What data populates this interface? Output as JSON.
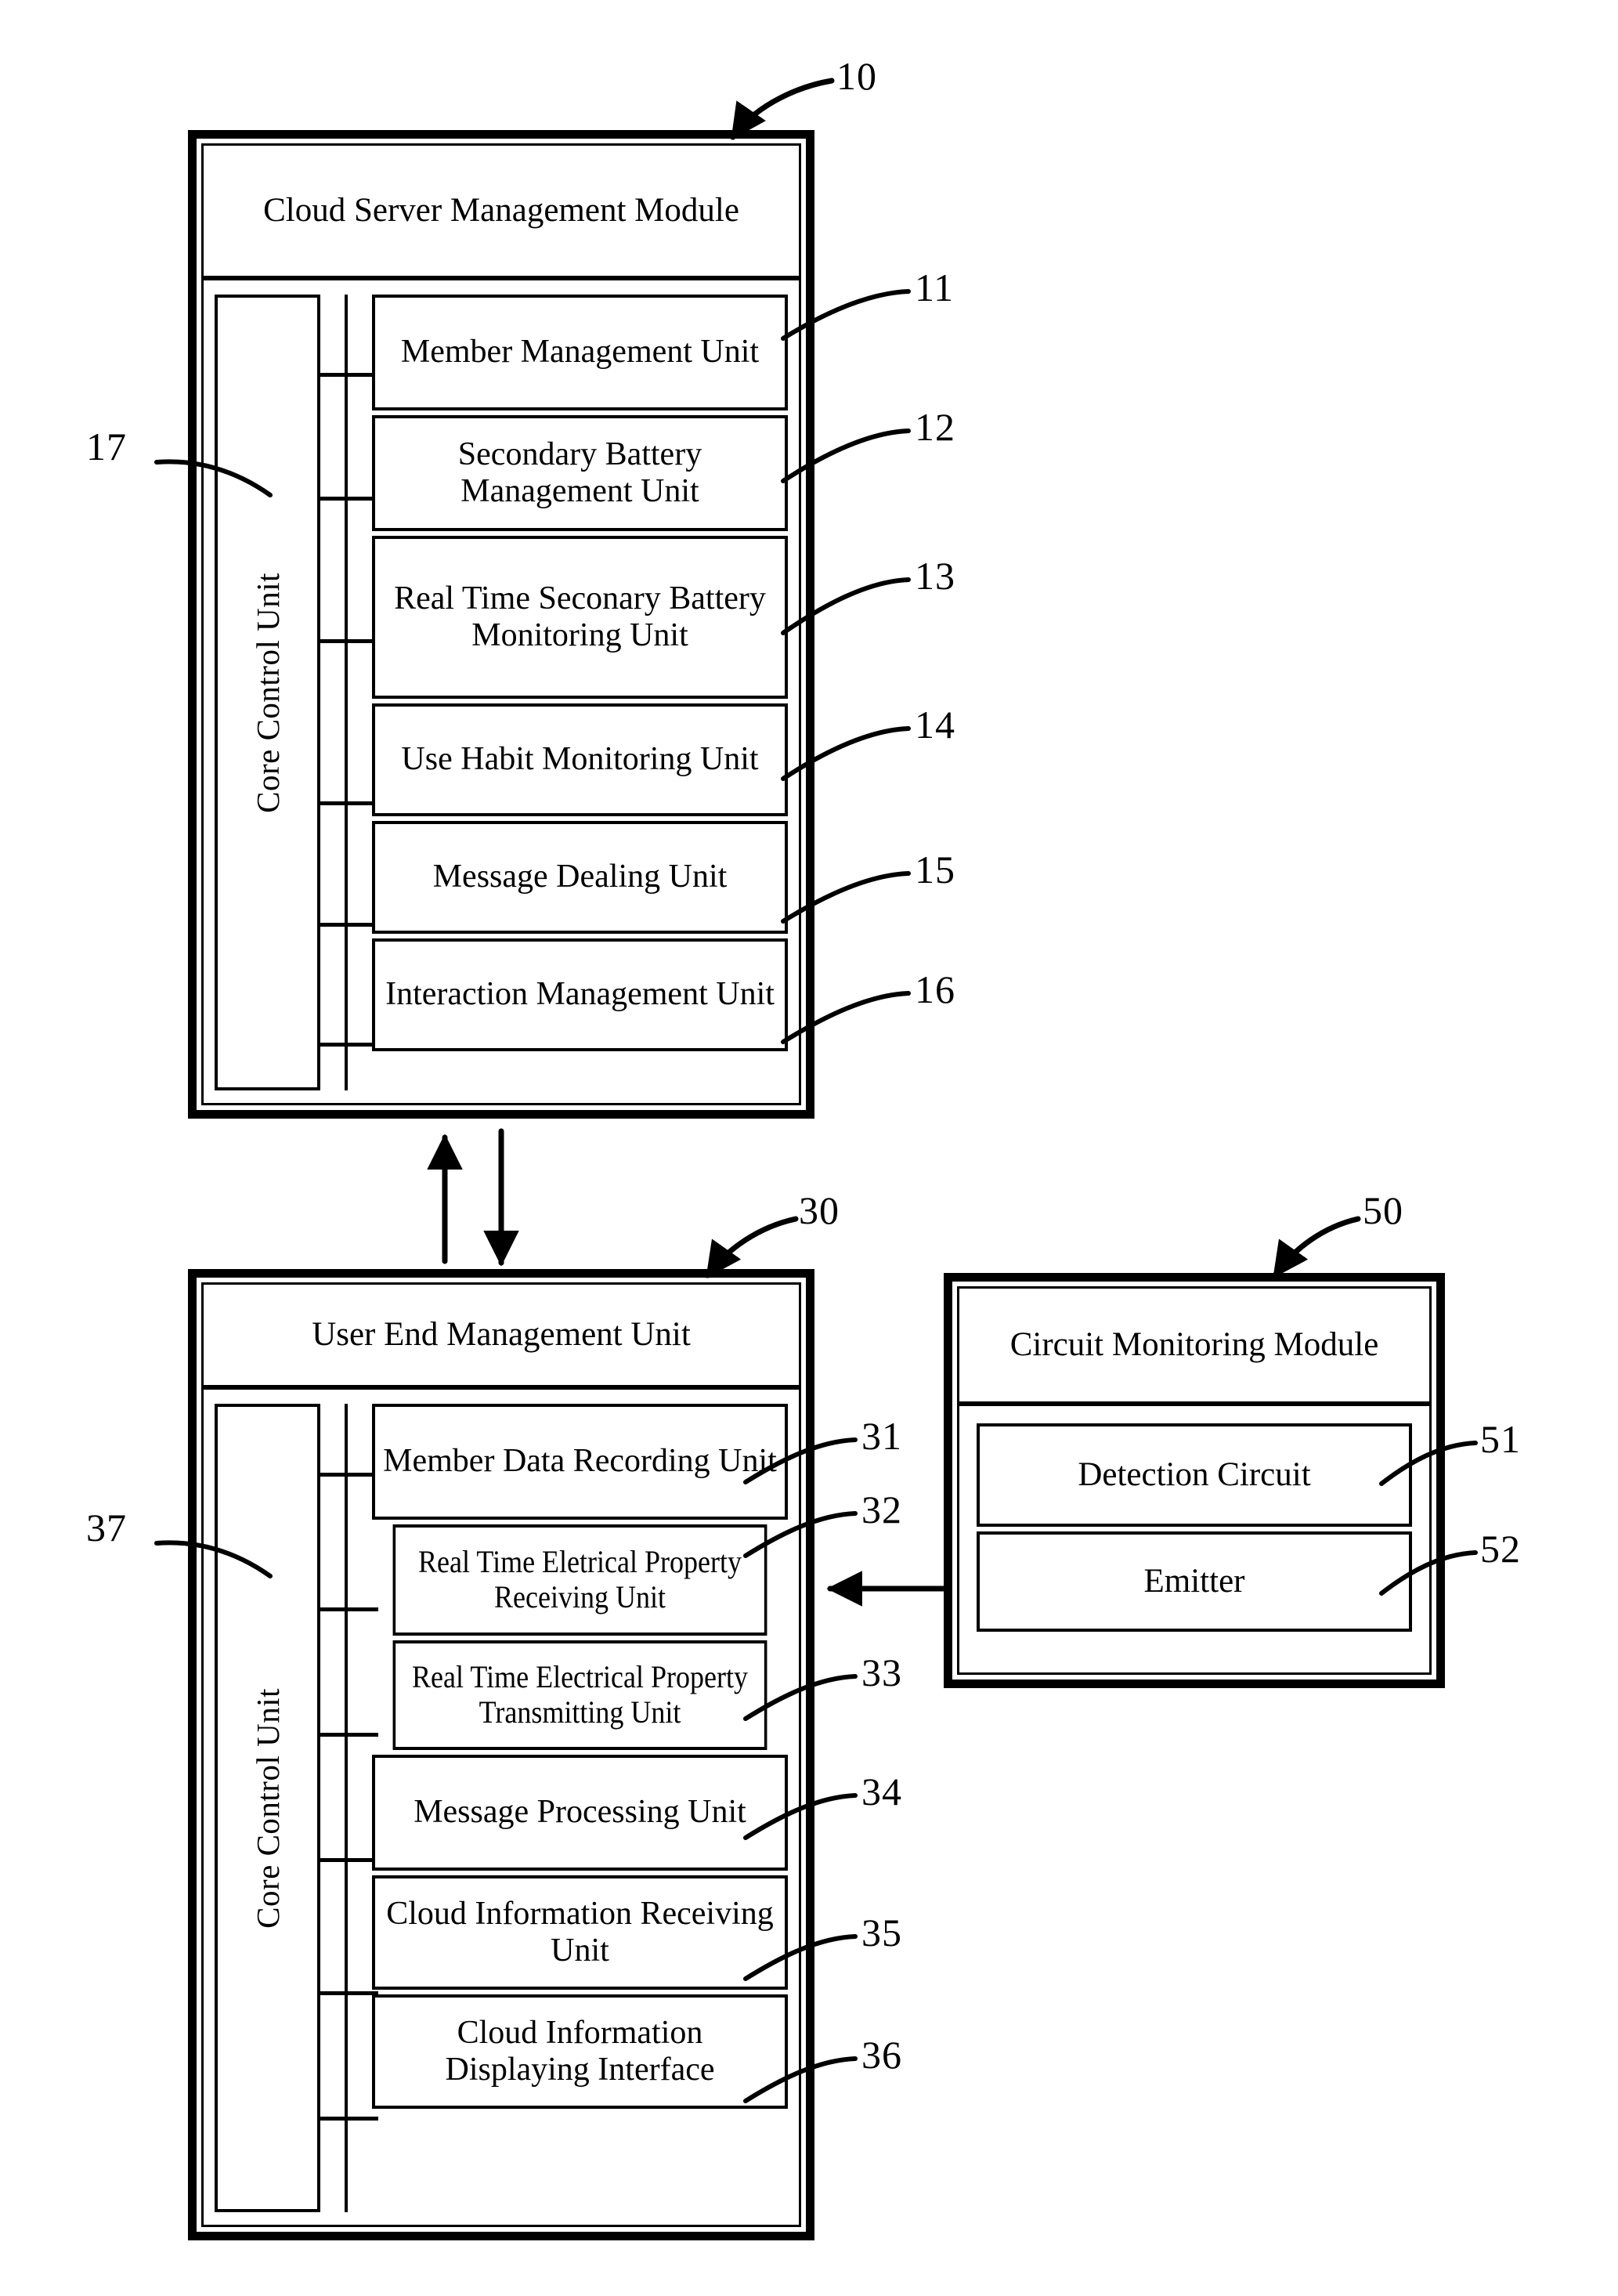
{
  "figure": {
    "background": "#ffffff",
    "line_color": "#000000"
  },
  "cloud_module": {
    "ref": "10",
    "title": "Cloud Server Management Module",
    "core_control": {
      "ref": "17",
      "label": "Core Control Unit"
    },
    "units": [
      {
        "ref": "11",
        "label": "Member Management Unit"
      },
      {
        "ref": "12",
        "label": "Secondary Battery Management Unit"
      },
      {
        "ref": "13",
        "label": "Real Time Seconary Battery Monitoring Unit"
      },
      {
        "ref": "14",
        "label": "Use Habit Monitoring Unit"
      },
      {
        "ref": "15",
        "label": "Message Dealing Unit"
      },
      {
        "ref": "16",
        "label": "Interaction Management Unit"
      }
    ]
  },
  "user_end_module": {
    "ref": "30",
    "title": "User End Management Unit",
    "core_control": {
      "ref": "37",
      "label": "Core Control Unit"
    },
    "units": [
      {
        "ref": "31",
        "label": "Member Data Recording Unit"
      },
      {
        "ref": "32",
        "label": "Real Time Eletrical Property Receiving Unit"
      },
      {
        "ref": "33",
        "label": "Real Time Electrical Property Transmitting Unit"
      },
      {
        "ref": "34",
        "label": "Message Processing Unit"
      },
      {
        "ref": "35",
        "label": "Cloud Information Receiving Unit"
      },
      {
        "ref": "36",
        "label": "Cloud Information Displaying Interface"
      }
    ]
  },
  "circuit_module": {
    "ref": "50",
    "title": "Circuit Monitoring Module",
    "units": [
      {
        "ref": "51",
        "label": "Detection Circuit"
      },
      {
        "ref": "52",
        "label": "Emitter"
      }
    ]
  },
  "connections": [
    {
      "name": "cloud-to-userend-up",
      "direction": "up"
    },
    {
      "name": "userend-to-cloud-down",
      "direction": "down"
    },
    {
      "name": "circuit-to-userend-left",
      "direction": "left"
    }
  ]
}
